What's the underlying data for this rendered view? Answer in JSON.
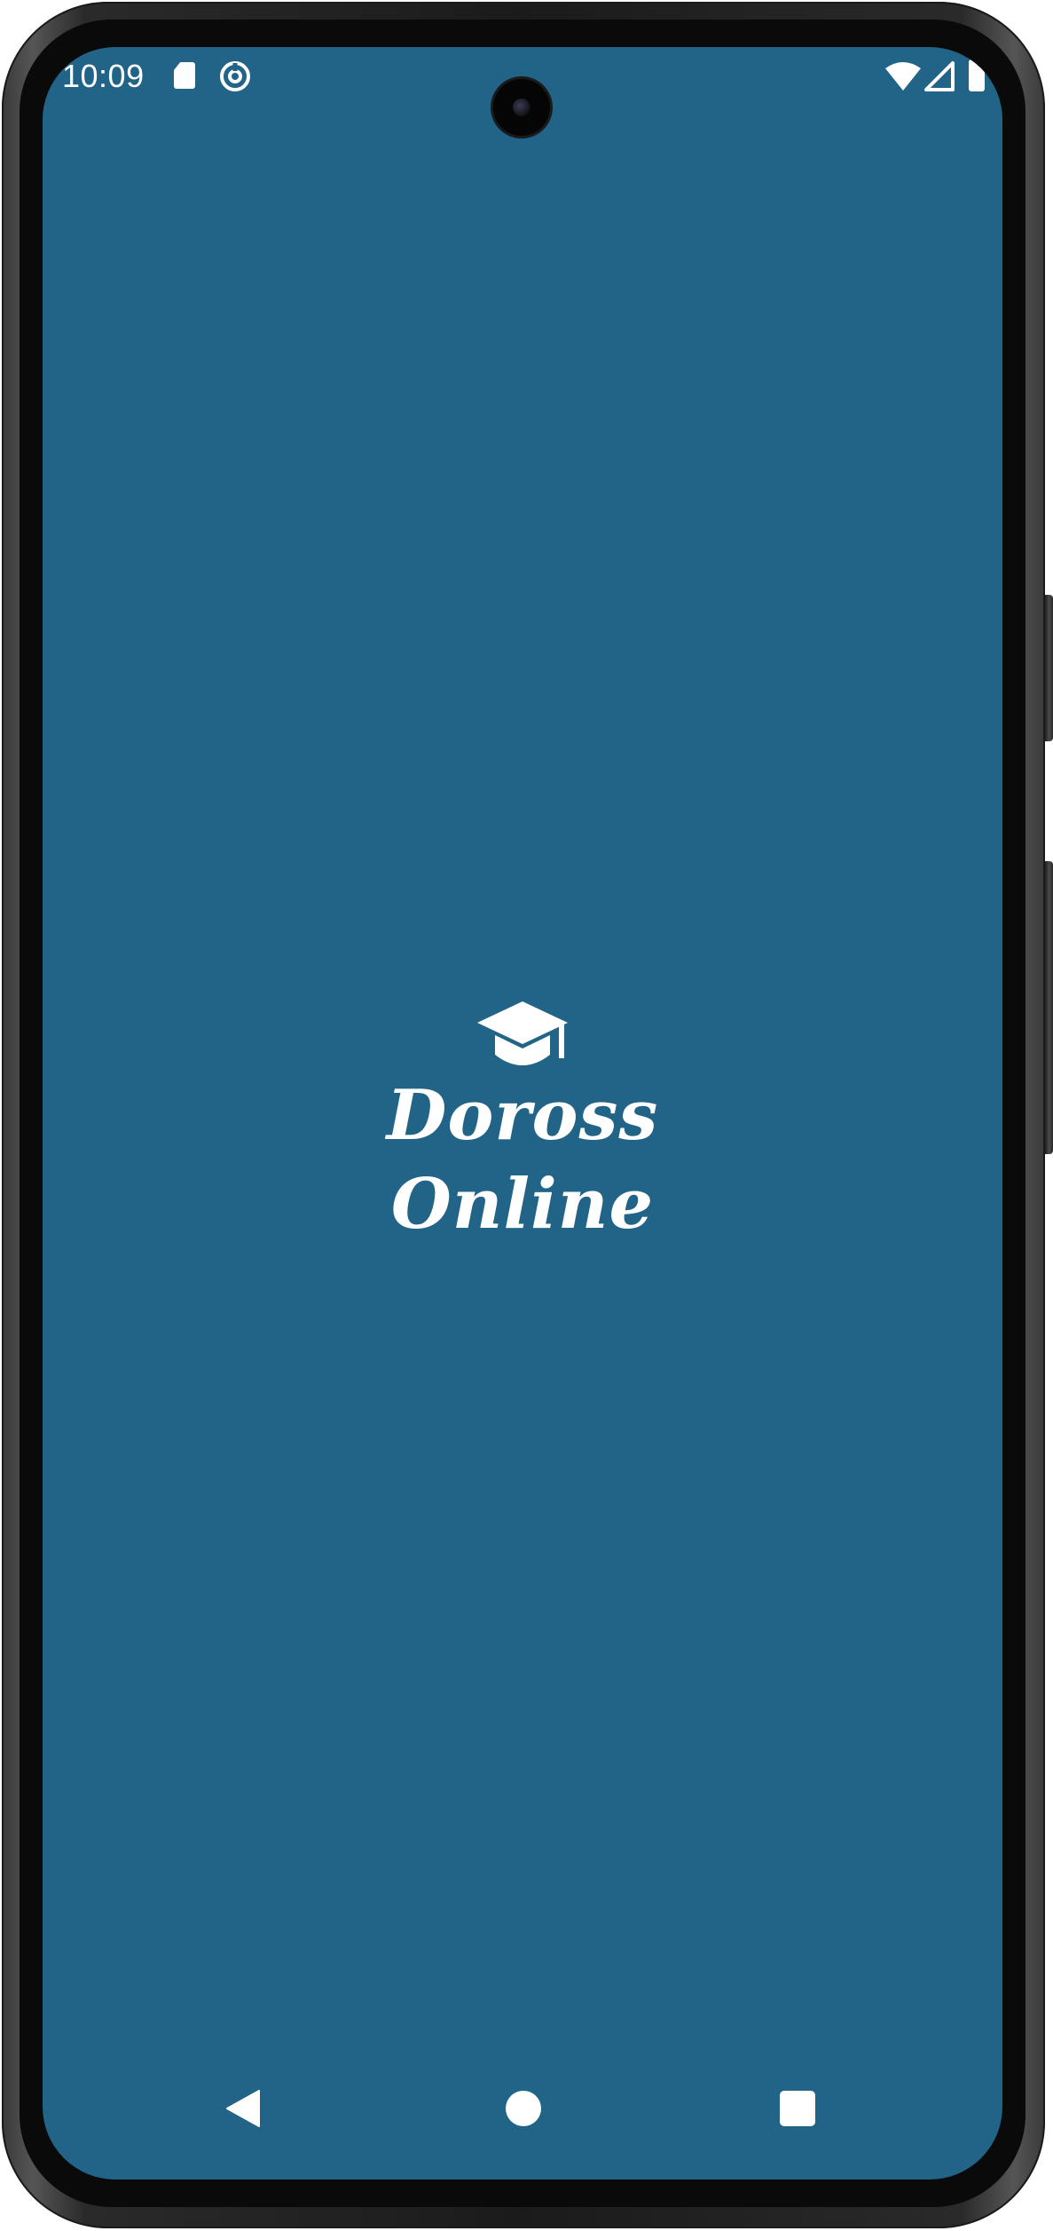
{
  "status_bar": {
    "time": "10:09",
    "icons": [
      "sd-card-icon",
      "sync-icon",
      "camera-cutout",
      "wifi-icon",
      "cell-signal-icon",
      "battery-icon"
    ]
  },
  "splash": {
    "logo_icon": "graduation-cap-icon",
    "title_line_1": "Doross",
    "title_line_2": "Online",
    "background_color": "#226488",
    "text_color": "#ffffff"
  },
  "nav_bar": {
    "buttons": [
      "back-icon",
      "home-icon",
      "recents-icon"
    ]
  }
}
